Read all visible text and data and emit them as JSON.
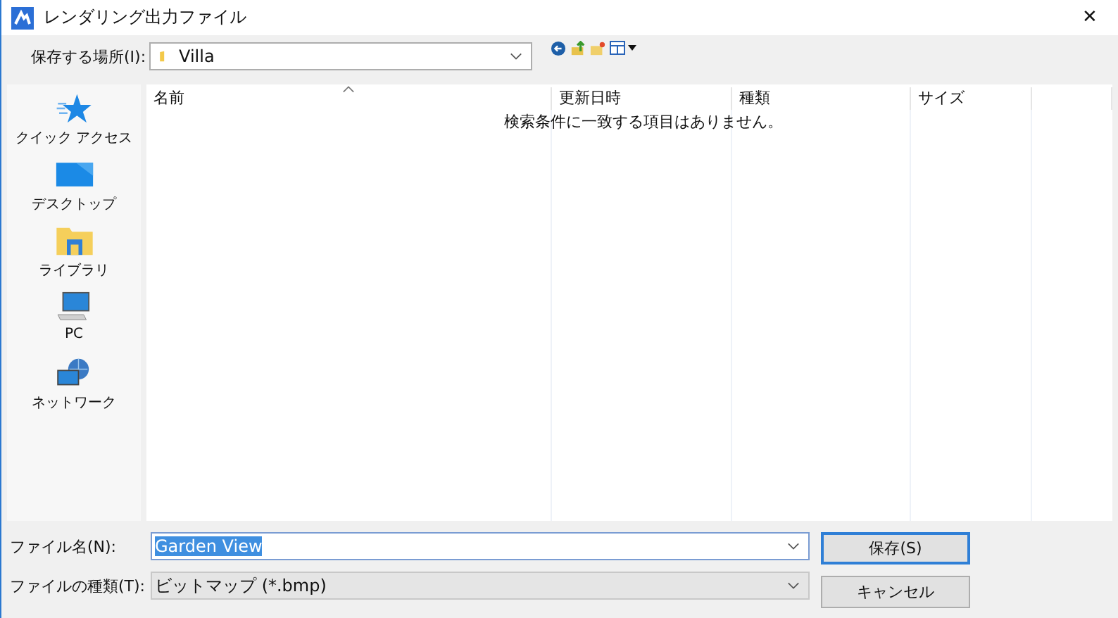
{
  "window": {
    "title": "レンダリング出力ファイル",
    "close": "✕"
  },
  "location": {
    "label": "保存する場所(I):",
    "value": "Villa"
  },
  "sidebar": {
    "items": [
      {
        "kind": "quick",
        "label": "クイック アクセス"
      },
      {
        "kind": "desktop",
        "label": "デスクトップ"
      },
      {
        "kind": "library",
        "label": "ライブラリ"
      },
      {
        "kind": "pc",
        "label": "PC"
      },
      {
        "kind": "network",
        "label": "ネットワーク"
      }
    ]
  },
  "table": {
    "columns": [
      {
        "label": "名前",
        "sorted": true
      },
      {
        "label": "更新日時",
        "sorted": false
      },
      {
        "label": "種類",
        "sorted": false
      },
      {
        "label": "サイズ",
        "sorted": false
      }
    ],
    "empty_message": "検索条件に一致する項目はありません。"
  },
  "file_name": {
    "label": "ファイル名(N):",
    "value": "Garden View",
    "text_selected": true
  },
  "file_type": {
    "label": "ファイルの種類(T):",
    "value": "ビットマップ (*.bmp)"
  },
  "buttons": [
    {
      "label": "保存(S)",
      "default": true
    },
    {
      "label": "キャンセル",
      "default": false
    }
  ]
}
